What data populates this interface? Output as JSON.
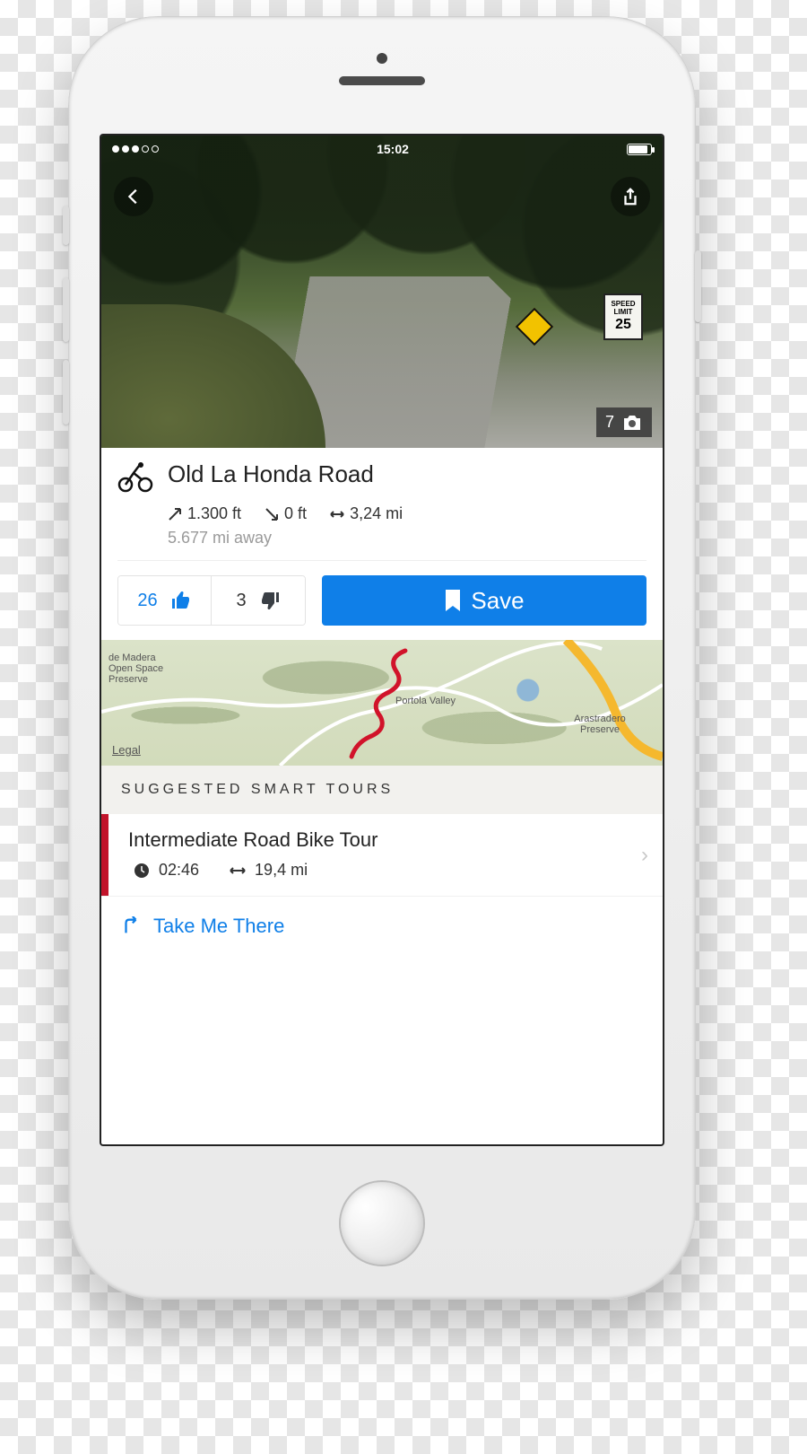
{
  "status_bar": {
    "time": "15:02"
  },
  "hero": {
    "photo_count": "7",
    "speed_limit_label": "SPEED LIMIT",
    "speed_limit_value": "25"
  },
  "route": {
    "title": "Old La Honda Road",
    "ascent": "1.300 ft",
    "descent": "0 ft",
    "distance": "3,24 mi",
    "away": "5.677 mi away"
  },
  "votes": {
    "up": "26",
    "down": "3"
  },
  "save_label": "Save",
  "map": {
    "place_1": "de Madera Open Space Preserve",
    "place_2": "Portola Valley",
    "place_3": "Arastradero Preserve",
    "legal": "Legal"
  },
  "suggested": {
    "header": "SUGGESTED SMART TOURS",
    "tour": {
      "title": "Intermediate Road Bike Tour",
      "duration": "02:46",
      "distance": "19,4 mi"
    }
  },
  "take_me_there": "Take Me There"
}
